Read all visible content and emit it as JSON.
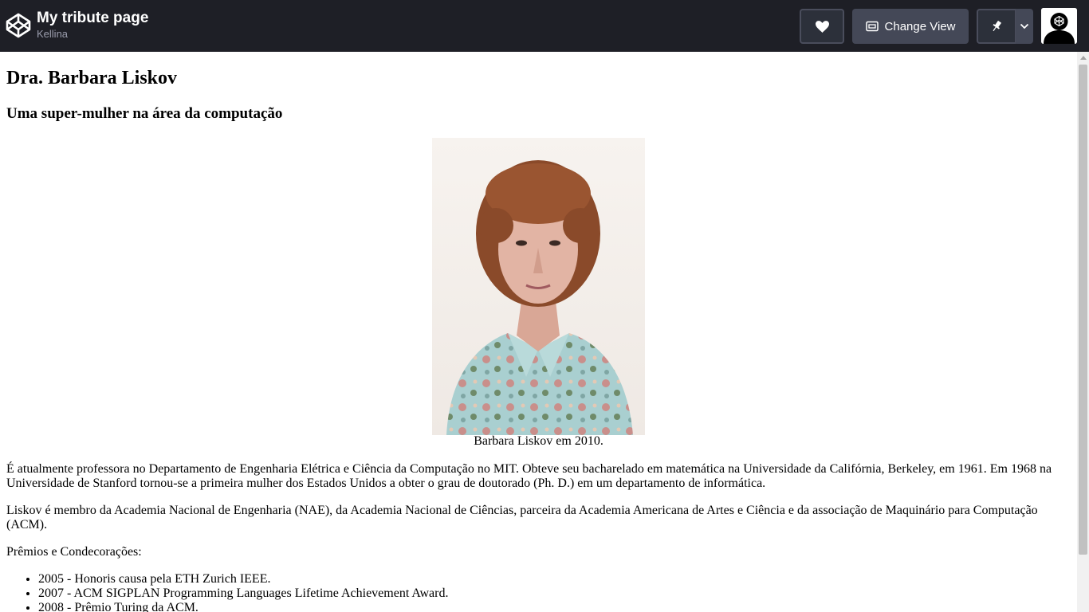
{
  "header": {
    "pen_title": "My tribute page",
    "author": "Kellina",
    "change_view_label": "Change View"
  },
  "page": {
    "title": "Dra. Barbara Liskov",
    "subtitle": "Uma super-mulher na área da computação",
    "image_caption": "Barbara Liskov em 2010.",
    "paragraphs": [
      "É atualmente professora no Departamento de Engenharia Elétrica e Ciência da Computação no MIT. Obteve seu bacharelado em matemática na Universidade da Califórnia, Berkeley, em 1961. Em 1968 na Universidade de Stanford tornou-se a primeira mulher dos Estados Unidos a obter o grau de doutorado (Ph. D.) em um departamento de informática.",
      "Liskov é membro da Academia Nacional de Engenharia (NAE), da Academia Nacional de Ciências, parceira da Academia Americana de Artes e Ciência e da associação de Maquinário para Computação (ACM).",
      "Prêmios e Condecorações:"
    ],
    "awards": [
      "2005 - Honoris causa pela ETH Zurich IEEE.",
      "2007 - ACM SIGPLAN Programming Languages Lifetime Achievement Award.",
      "2008 - Prêmio Turing da ACM."
    ]
  },
  "icons": {
    "logo": "codepen-logo-icon",
    "heart": "heart-icon",
    "view": "change-view-icon",
    "pin": "pin-icon",
    "dropdown": "chevron-down-icon",
    "avatar": "user-avatar"
  },
  "colors": {
    "topbar_bg": "#1e1f26",
    "button_bg": "#444857",
    "button_dark": "#2c303a",
    "muted_text": "#9b9dad"
  }
}
